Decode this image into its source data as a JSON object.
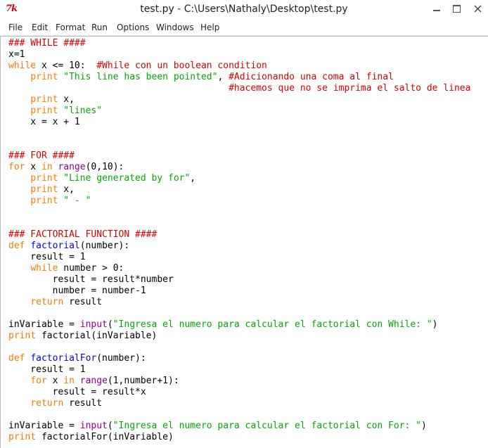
{
  "window": {
    "title": "test.py - C:\\Users\\Nathaly\\Desktop\\test.py",
    "app_icon_text": "7k"
  },
  "menu": [
    "File",
    "Edit",
    "Format",
    "Run",
    "Options",
    "Windows",
    "Help"
  ],
  "colors": {
    "keyword": "#ff7700",
    "builtin": "#900090",
    "string": "#00aa00",
    "comment": "#dd0000",
    "definition": "#0000ff",
    "plain": "#000000"
  },
  "code_lines": [
    [
      [
        "c",
        "### WHILE ####"
      ]
    ],
    [
      [
        "p",
        "x=1"
      ]
    ],
    [
      [
        "k",
        "while"
      ],
      [
        "p",
        " x <= 10:  "
      ],
      [
        "c",
        "#While con un boolean condition"
      ]
    ],
    [
      [
        "p",
        "    "
      ],
      [
        "k",
        "print"
      ],
      [
        "p",
        " "
      ],
      [
        "s",
        "\"This line has been pointed\""
      ],
      [
        "p",
        ", "
      ],
      [
        "c",
        "#Adicionando una coma al final"
      ]
    ],
    [
      [
        "p",
        "                                        "
      ],
      [
        "c",
        "#hacemos que no se imprima el salto de linea"
      ]
    ],
    [
      [
        "p",
        "    "
      ],
      [
        "k",
        "print"
      ],
      [
        "p",
        " x,"
      ]
    ],
    [
      [
        "p",
        "    "
      ],
      [
        "k",
        "print"
      ],
      [
        "p",
        " "
      ],
      [
        "s",
        "\"lines\""
      ]
    ],
    [
      [
        "p",
        "    x = x + 1"
      ]
    ],
    [],
    [],
    [
      [
        "c",
        "### FOR ####"
      ]
    ],
    [
      [
        "k",
        "for"
      ],
      [
        "p",
        " x "
      ],
      [
        "k",
        "in"
      ],
      [
        "p",
        " "
      ],
      [
        "b",
        "range"
      ],
      [
        "p",
        "(0,10):"
      ]
    ],
    [
      [
        "p",
        "    "
      ],
      [
        "k",
        "print"
      ],
      [
        "p",
        " "
      ],
      [
        "s",
        "\"Line generated by for\""
      ],
      [
        "p",
        ","
      ]
    ],
    [
      [
        "p",
        "    "
      ],
      [
        "k",
        "print"
      ],
      [
        "p",
        " x,"
      ]
    ],
    [
      [
        "p",
        "    "
      ],
      [
        "k",
        "print"
      ],
      [
        "p",
        " "
      ],
      [
        "s",
        "\" - \""
      ]
    ],
    [],
    [],
    [
      [
        "c",
        "### FACTORIAL FUNCTION ####"
      ]
    ],
    [
      [
        "k",
        "def"
      ],
      [
        "p",
        " "
      ],
      [
        "d",
        "factorial"
      ],
      [
        "p",
        "(number):"
      ]
    ],
    [
      [
        "p",
        "    result = 1"
      ]
    ],
    [
      [
        "p",
        "    "
      ],
      [
        "k",
        "while"
      ],
      [
        "p",
        " number > 0:"
      ]
    ],
    [
      [
        "p",
        "        result = result*number"
      ]
    ],
    [
      [
        "p",
        "        number = number-1"
      ]
    ],
    [
      [
        "p",
        "    "
      ],
      [
        "k",
        "return"
      ],
      [
        "p",
        " result"
      ]
    ],
    [],
    [
      [
        "p",
        "inVariable = "
      ],
      [
        "b",
        "input"
      ],
      [
        "p",
        "("
      ],
      [
        "s",
        "\"Ingresa el numero para calcular el factorial con While: \""
      ],
      [
        "p",
        ")"
      ]
    ],
    [
      [
        "k",
        "print"
      ],
      [
        "p",
        " factorial(inVariable)"
      ]
    ],
    [],
    [
      [
        "k",
        "def"
      ],
      [
        "p",
        " "
      ],
      [
        "d",
        "factorialFor"
      ],
      [
        "p",
        "(number):"
      ]
    ],
    [
      [
        "p",
        "    result = 1"
      ]
    ],
    [
      [
        "p",
        "    "
      ],
      [
        "k",
        "for"
      ],
      [
        "p",
        " x "
      ],
      [
        "k",
        "in"
      ],
      [
        "p",
        " "
      ],
      [
        "b",
        "range"
      ],
      [
        "p",
        "(1,number+1):"
      ]
    ],
    [
      [
        "p",
        "        result = result*x"
      ]
    ],
    [
      [
        "p",
        "    "
      ],
      [
        "k",
        "return"
      ],
      [
        "p",
        " result"
      ]
    ],
    [],
    [
      [
        "p",
        "inVariable = "
      ],
      [
        "b",
        "input"
      ],
      [
        "p",
        "("
      ],
      [
        "s",
        "\"Ingresa el numero para calcular el factorial con For: \""
      ],
      [
        "p",
        ")"
      ]
    ],
    [
      [
        "k",
        "print"
      ],
      [
        "p",
        " factorialFor(inVariable)"
      ]
    ]
  ]
}
